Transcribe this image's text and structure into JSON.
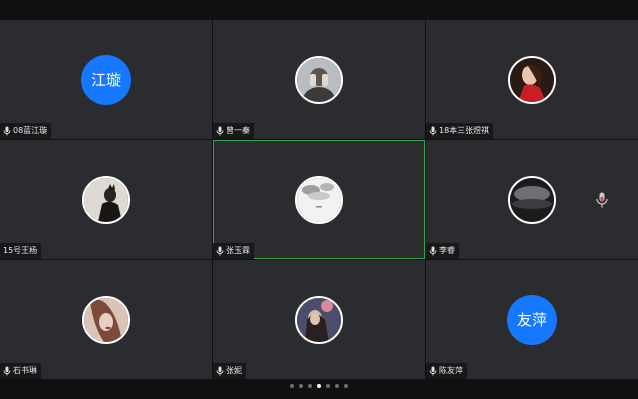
{
  "accent_avatar_color": "#1677ff",
  "active_border_color": "#2fa84f",
  "participants": [
    {
      "name": "08蓝江璇",
      "avatar_text": "江璇",
      "mic": true
    },
    {
      "name": "曾一秦",
      "mic": true
    },
    {
      "name": "18本三张煜祺",
      "mic": true
    },
    {
      "name": "15号王杨",
      "mic": false
    },
    {
      "name": "张玉霖",
      "mic": true
    },
    {
      "name": "李睿",
      "mic": true
    },
    {
      "name": "石书琳",
      "mic": true
    },
    {
      "name": "张妮",
      "mic": true
    },
    {
      "name": "陈友萍",
      "avatar_text": "友萍",
      "mic": true
    }
  ],
  "pagination": {
    "total": 7,
    "current": 4
  }
}
